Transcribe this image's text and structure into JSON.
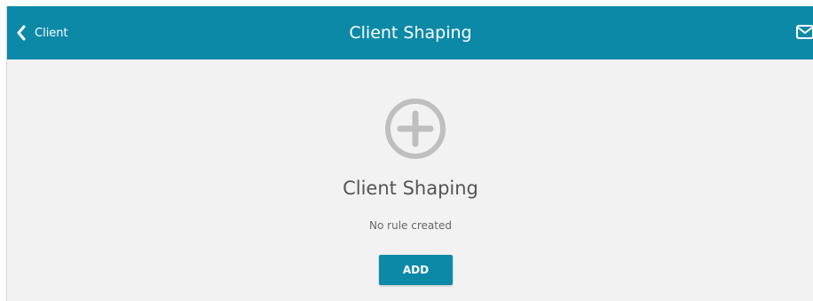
{
  "header": {
    "back_label": "Client",
    "title": "Client Shaping",
    "back_icon": "chevron-left-icon",
    "notifications_icon": "mail-icon"
  },
  "empty_state": {
    "icon": "plus-circle-icon",
    "title": "Client Shaping",
    "message": "No rule created",
    "add_label": "ADD"
  },
  "colors": {
    "accent": "#0d89a8",
    "background": "#f2f2f2",
    "icon_gray": "#bfbfbf"
  }
}
